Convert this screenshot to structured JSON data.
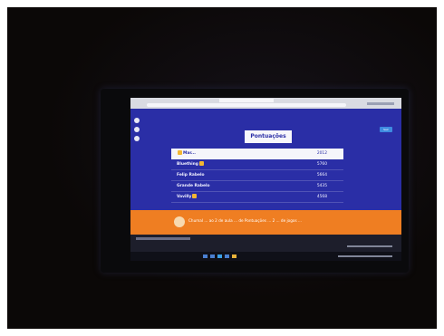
{
  "page": {
    "title": "Pontuações",
    "button_label": "Sair"
  },
  "leaderboard": {
    "rows": [
      {
        "name": "Mar...",
        "value": "2012"
      },
      {
        "name": "Bluething",
        "value": "5760"
      },
      {
        "name": "Felip Rabelo",
        "value": "5664"
      },
      {
        "name": "Grande Rabelo",
        "value": "5435"
      },
      {
        "name": "Vavilly",
        "value": "4568"
      }
    ]
  },
  "banner": {
    "text": "Chumal ... ao 2 de aula ... de Pontuações ... 2 ... de jogos ..."
  },
  "colors": {
    "screen_bg": "#2a2ea6",
    "banner_bg": "#ef7e22",
    "photo_bg": "#0b0807"
  }
}
